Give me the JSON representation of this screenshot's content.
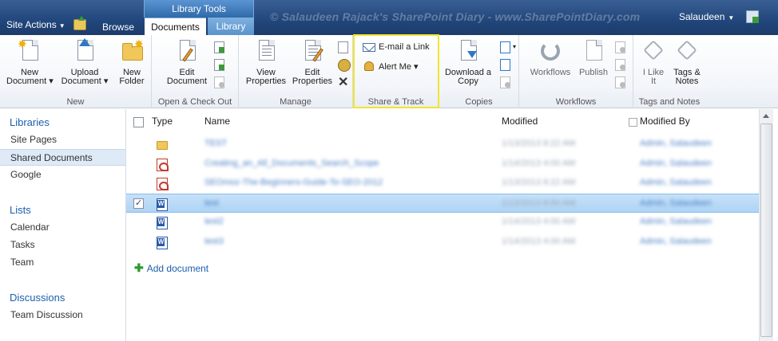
{
  "topbar": {
    "site_actions": "Site Actions",
    "browse_tab": "Browse",
    "library_tools": "Library Tools",
    "documents_tab": "Documents",
    "library_tab": "Library",
    "watermark": "© Salaudeen Rajack's SharePoint Diary - www.SharePointDiary.com",
    "user": "Salaudeen"
  },
  "ribbon": {
    "new": {
      "label": "New",
      "new_document": [
        "New",
        "Document"
      ],
      "upload_document": [
        "Upload",
        "Document"
      ],
      "new_folder": [
        "New",
        "Folder"
      ]
    },
    "open_checkout": {
      "label": "Open & Check Out",
      "edit_document": [
        "Edit",
        "Document"
      ]
    },
    "manage": {
      "label": "Manage",
      "view_properties": [
        "View",
        "Properties"
      ],
      "edit_properties": [
        "Edit",
        "Properties"
      ]
    },
    "share_track": {
      "label": "Share & Track",
      "email_link": "E-mail a Link",
      "alert_me": "Alert Me"
    },
    "copies": {
      "label": "Copies",
      "download_copy": [
        "Download a",
        "Copy"
      ]
    },
    "workflows": {
      "label": "Workflows",
      "workflows_btn": "Workflows",
      "publish": "Publish"
    },
    "tags_notes": {
      "label": "Tags and Notes",
      "i_like_it": [
        "I Like",
        "It"
      ],
      "tags_notes_btn": [
        "Tags &",
        "Notes"
      ]
    }
  },
  "leftnav": {
    "libraries": "Libraries",
    "library_items": [
      "Site Pages",
      "Shared Documents",
      "Google"
    ],
    "lists": "Lists",
    "list_items": [
      "Calendar",
      "Tasks",
      "Team"
    ],
    "discussions": "Discussions",
    "discussion_items": [
      "Team Discussion"
    ]
  },
  "list": {
    "headers": {
      "type": "Type",
      "name": "Name",
      "modified": "Modified",
      "modified_by": "Modified By"
    },
    "rows": [
      {
        "type": "folder",
        "name": "TEST",
        "modified": "1/13/2013 8:22 AM",
        "modified_by": "Admin, Salaudeen"
      },
      {
        "type": "pdf",
        "name": "Creating_an_All_Documents_Search_Scope",
        "modified": "1/14/2013 4:00 AM",
        "modified_by": "Admin, Salaudeen"
      },
      {
        "type": "pdf",
        "name": "SEOmoz-The-Beginners-Guide-To-SEO-2012",
        "modified": "1/13/2013 8:22 AM",
        "modified_by": "Admin, Salaudeen"
      },
      {
        "type": "word",
        "name": "test",
        "modified": "1/13/2013 8:50 AM",
        "modified_by": "Admin, Salaudeen"
      },
      {
        "type": "word",
        "name": "test2",
        "modified": "1/14/2013 4:00 AM",
        "modified_by": "Admin, Salaudeen"
      },
      {
        "type": "word",
        "name": "test3",
        "modified": "1/14/2013 4:00 AM",
        "modified_by": "Admin, Salaudeen"
      }
    ],
    "selected_row": 3,
    "add_document": "Add document"
  },
  "colors": {
    "accent": "#1c5fae",
    "topbar": "#21467b",
    "highlight": "#f2e42e",
    "selected_row": "#aed4f5"
  }
}
